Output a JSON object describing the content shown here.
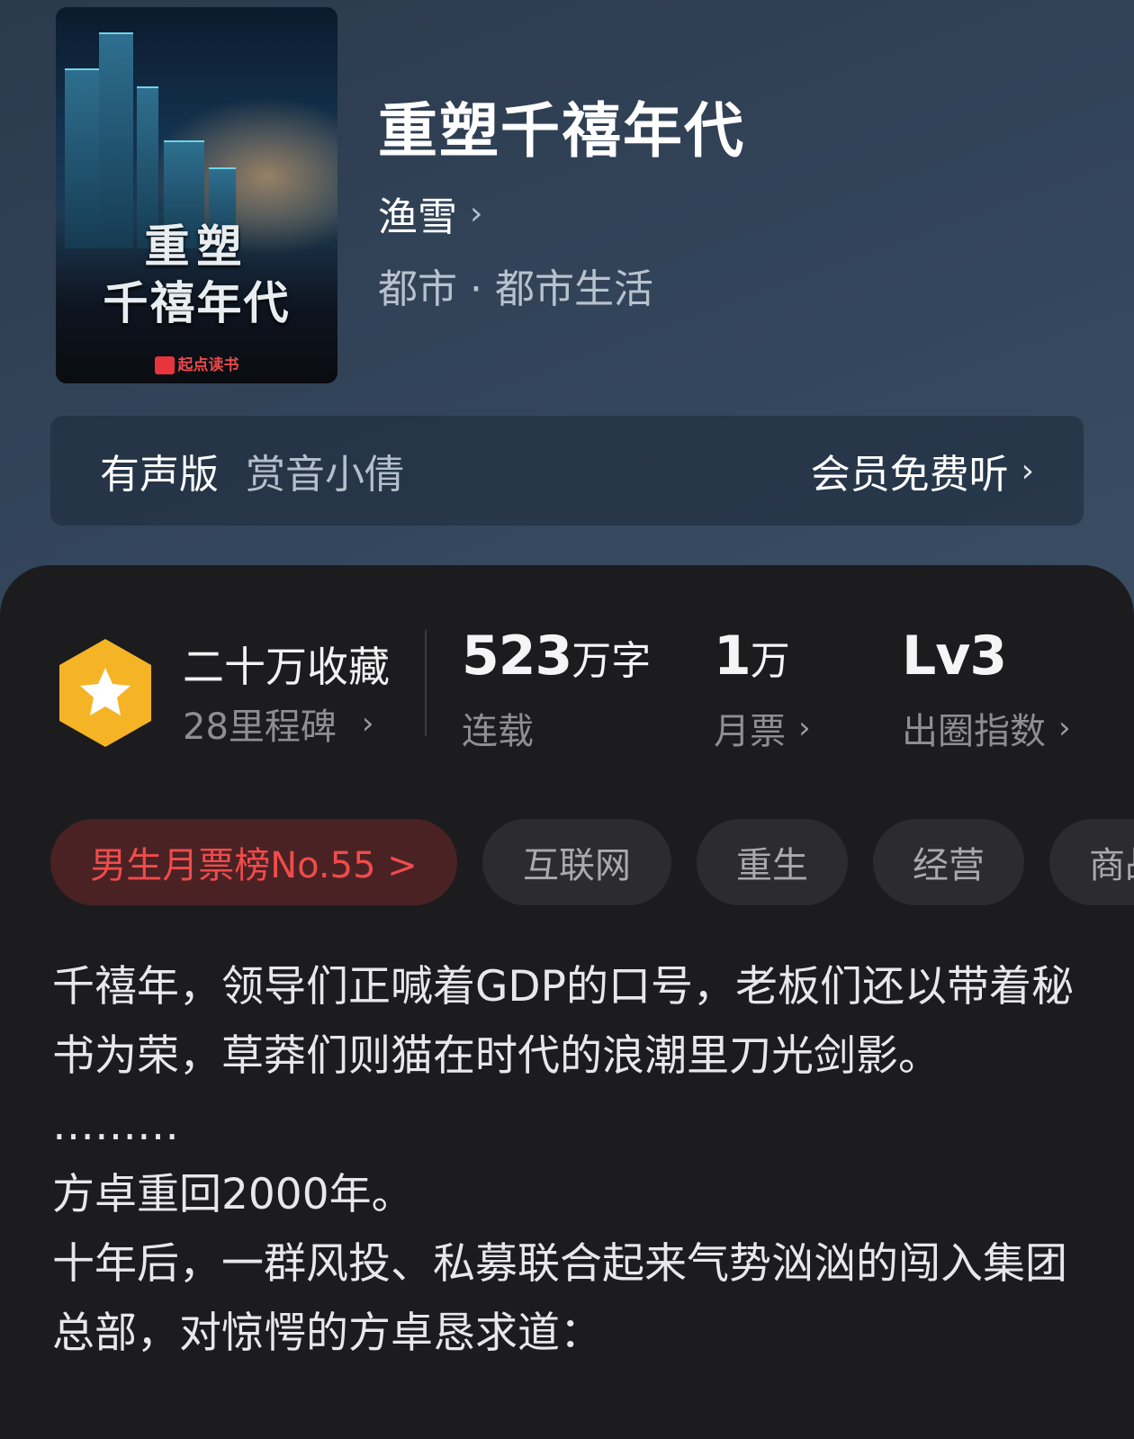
{
  "cover": {
    "title_line1": "重塑",
    "title_line2": "千禧年代",
    "publisher": "起点读书"
  },
  "book": {
    "title": "重塑千禧年代",
    "author": "渔雪",
    "genre": "都市 · 都市生活"
  },
  "audio": {
    "label": "有声版",
    "narrator": "赏音小倩",
    "cta": "会员免费听"
  },
  "stats": {
    "collect_title": "二十万收藏",
    "collect_sub": "28里程碑",
    "words_value": "523",
    "words_unit": "万字",
    "words_label": "连载",
    "tickets_value": "1",
    "tickets_unit": "万",
    "tickets_label": "月票",
    "level_value": "Lv3",
    "level_label": "出圈指数"
  },
  "tags": {
    "rank": "男生月票榜No.55 >",
    "items": [
      "互联网",
      "重生",
      "经营",
      "商战"
    ]
  },
  "description": [
    "千禧年，领导们正喊着GDP的口号，老板们还以带着秘书为荣，草莽们则猫在时代的浪潮里刀光剑影。",
    "………",
    "方卓重回2000年。",
    "十年后，一群风投、私募联合起来气势汹汹的闯入集团总部，对惊愕的方卓恳求道："
  ],
  "colors": {
    "header_bg": "#34465c",
    "card_bg": "#1c1c1e",
    "rank_tag_text": "#f04b4b",
    "rank_tag_bg": "#4a2224",
    "badge": "#f5b326"
  }
}
